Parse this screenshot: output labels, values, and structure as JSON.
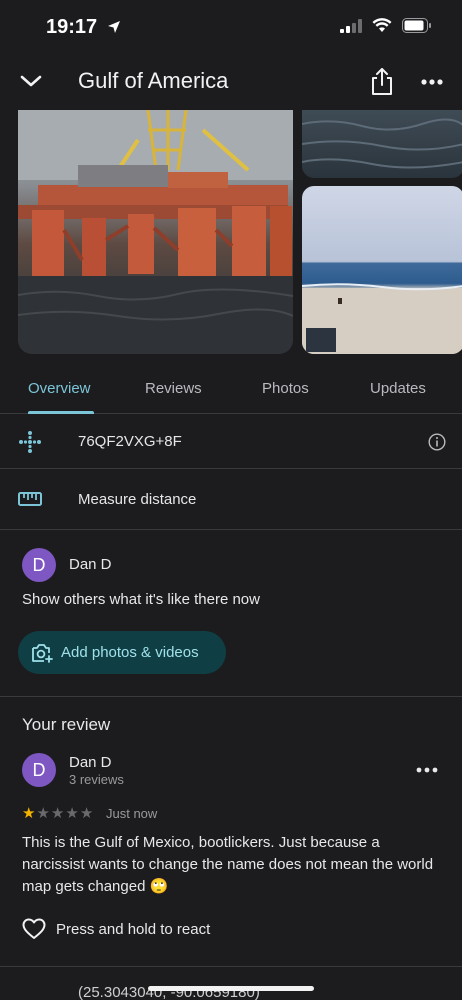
{
  "status_bar": {
    "time": "19:17"
  },
  "header": {
    "title": "Gulf of America"
  },
  "tabs": [
    {
      "label": "Overview"
    },
    {
      "label": "Reviews"
    },
    {
      "label": "Photos"
    },
    {
      "label": "Updates"
    }
  ],
  "details": {
    "plus_code": "76QF2VXG+8F",
    "measure_label": "Measure distance"
  },
  "contribute": {
    "user_initial": "D",
    "user_name": "Dan D",
    "prompt": "Show others what it's like there now",
    "add_button_label": "Add photos & videos"
  },
  "your_review": {
    "section_title": "Your review",
    "user_initial": "D",
    "user_name": "Dan D",
    "review_count": "3 reviews",
    "rating": 1,
    "max_rating": 5,
    "time": "Just now",
    "text": "This is the Gulf of Mexico, bootlickers. Just because a narcissist wants to change the name does not mean the world map gets changed 🙄",
    "react_label": "Press and hold to react"
  },
  "coordinates": "(25.3043040, -90.0659180)",
  "colors": {
    "accent": "#7cc5d8",
    "avatar": "#7e57c2",
    "star": "#f5b400",
    "button_bg": "#0f3f44"
  }
}
